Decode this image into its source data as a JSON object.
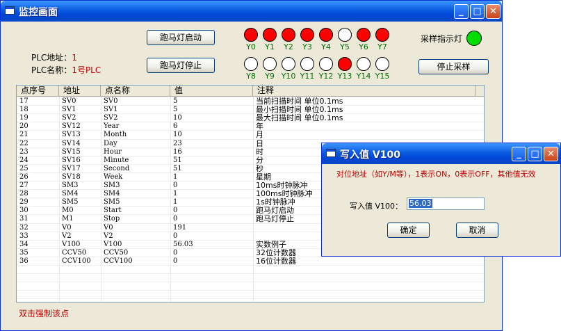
{
  "main_window": {
    "title": "监控画面",
    "buttons": {
      "start": "跑马灯启动",
      "stop": "跑马灯停止",
      "stop_sampling": "停止采样"
    },
    "plc_address_label": "PLC地址：",
    "plc_address_value": "1",
    "plc_name_label": "PLC名称：",
    "plc_name_value": "1号PLC",
    "sampling_indicator_label": "采样指示灯",
    "sampling_indicator_color": "#00DD00",
    "footer_hint": "双击强制该点",
    "lamps_row1": [
      {
        "label": "Y0",
        "color": "#FF0000"
      },
      {
        "label": "Y1",
        "color": "#FF0000"
      },
      {
        "label": "Y2",
        "color": "#FF0000"
      },
      {
        "label": "Y3",
        "color": "#FF0000"
      },
      {
        "label": "Y4",
        "color": "#FF0000"
      },
      {
        "label": "Y5",
        "color": "#FFFFFF"
      },
      {
        "label": "Y6",
        "color": "#FF0000"
      },
      {
        "label": "Y7",
        "color": "#FF0000"
      }
    ],
    "lamps_row2": [
      {
        "label": "Y8",
        "color": "#FFFFFF"
      },
      {
        "label": "Y9",
        "color": "#FFFFFF"
      },
      {
        "label": "Y10",
        "color": "#FFFFFF"
      },
      {
        "label": "Y11",
        "color": "#FFFFFF"
      },
      {
        "label": "Y12",
        "color": "#FFFFFF"
      },
      {
        "label": "Y13",
        "color": "#FF0000"
      },
      {
        "label": "Y14",
        "color": "#FFFFFF"
      },
      {
        "label": "Y15",
        "color": "#FFFFFF"
      }
    ]
  },
  "table": {
    "columns": [
      "点序号",
      "地址",
      "点名称",
      "值",
      "注释"
    ],
    "rows": [
      [
        "17",
        "SV0",
        "SV0",
        "5",
        "当前扫描时间 单位0.1ms"
      ],
      [
        "18",
        "SV1",
        "SV1",
        "5",
        "最小扫描时间 单位0.1ms"
      ],
      [
        "19",
        "SV2",
        "SV2",
        "10",
        "最大扫描时间 单位0.1ms"
      ],
      [
        "20",
        "SV12",
        "Year",
        "6",
        "年"
      ],
      [
        "21",
        "SV13",
        "Month",
        "10",
        "月"
      ],
      [
        "22",
        "SV14",
        "Day",
        "23",
        "日"
      ],
      [
        "23",
        "SV15",
        "Hour",
        "16",
        "时"
      ],
      [
        "24",
        "SV16",
        "Minute",
        "51",
        "分"
      ],
      [
        "25",
        "SV17",
        "Second",
        "51",
        "秒"
      ],
      [
        "26",
        "SV18",
        "Week",
        "1",
        "星期"
      ],
      [
        "27",
        "SM3",
        "SM3",
        "0",
        "10ms时钟脉冲"
      ],
      [
        "28",
        "SM4",
        "SM4",
        "1",
        "100ms时钟脉冲"
      ],
      [
        "29",
        "SM5",
        "SM5",
        "1",
        "1s时钟脉冲"
      ],
      [
        "30",
        "M0",
        "Start",
        "0",
        "跑马灯启动"
      ],
      [
        "31",
        "M1",
        "Stop",
        "0",
        "跑马灯停止"
      ],
      [
        "32",
        "V0",
        "V0",
        "191",
        ""
      ],
      [
        "33",
        "V2",
        "V2",
        "0",
        ""
      ],
      [
        "34",
        "V100",
        "V100",
        "56.03",
        "实数例子"
      ],
      [
        "35",
        "CCV50",
        "CCV50",
        "0",
        "32位计数器"
      ],
      [
        "36",
        "CCV100",
        "CCV100",
        "0",
        "16位计数器"
      ]
    ]
  },
  "dialog": {
    "title": "写入值 V100",
    "hint": "对位地址（如Y/M等），1表示ON，0表示OFF，其他值无效",
    "input_label": "写入值 V100：",
    "input_value": "56.03",
    "ok": "确定",
    "cancel": "取消"
  }
}
